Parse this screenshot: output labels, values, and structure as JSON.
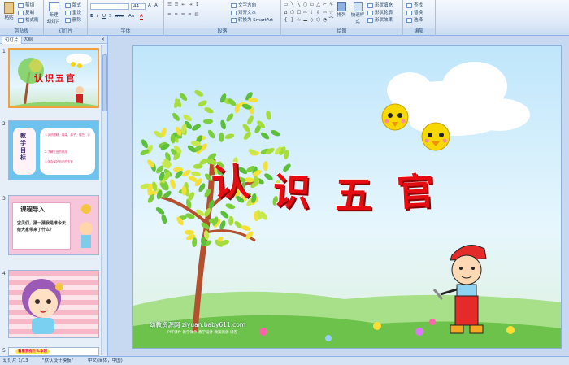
{
  "ribbon": {
    "clipboard": {
      "paste": "粘贴",
      "cut": "剪切",
      "copy": "复制",
      "format_painter": "格式刷",
      "group": "剪贴板"
    },
    "slides": {
      "new_slide": "新建\n幻灯片",
      "layout": "版式",
      "reset": "重设",
      "delete": "删除",
      "group": "幻灯片"
    },
    "font": {
      "size": "44",
      "bold": "B",
      "italic": "I",
      "underline": "U",
      "shadow": "S",
      "strike": "abc",
      "aa": "Aa",
      "font_color": "A",
      "group": "字体"
    },
    "paragraph": {
      "text_direction": "文字方向",
      "align_text": "对齐文本",
      "smartart": "转换为 SmartArt",
      "group": "段落"
    },
    "drawing": {
      "arrange": "排列",
      "quick_styles": "快速样式",
      "shape_fill": "形状填充",
      "shape_outline": "形状轮廓",
      "shape_effects": "形状效果",
      "group": "绘图"
    },
    "editing": {
      "find": "查找",
      "replace": "替换",
      "select": "选择",
      "group": "编辑"
    }
  },
  "pane": {
    "tab_slides": "幻灯片",
    "tab_outline": "大纲",
    "close": "×",
    "thumbs": [
      {
        "num": "1",
        "title": "认识五官"
      },
      {
        "num": "2",
        "label": "教学目标",
        "lines": [
          "1.认识眼睛、耳朵、鼻子、嘴巴、手",
          "2.了解五官的作用",
          "3.学会保护自己的五官"
        ]
      },
      {
        "num": "3",
        "label": "课程导入",
        "text": "宝贝们，猜一猜我是谁今天给大家带来了什么？"
      },
      {
        "num": "4",
        "label": ""
      },
      {
        "num": "5",
        "label": "看看我有什么本领"
      }
    ]
  },
  "slide": {
    "title_chars": [
      "认",
      "识",
      "五",
      "官"
    ],
    "watermark": "幼教资源网 ziyuan.baby611.com",
    "watermark_sub": "PPT课件  教学课件  教学设计  教案资源  试卷"
  },
  "status": {
    "slide_count": "幻灯片 1/13",
    "theme": "\"默认设计模板\"",
    "language": "中文(简体，中国)"
  },
  "colors": {
    "ribbon_bg": "#dce8f7",
    "accent": "#f0a040",
    "title_red": "#e60d12",
    "sky": "#bfe6fb"
  }
}
